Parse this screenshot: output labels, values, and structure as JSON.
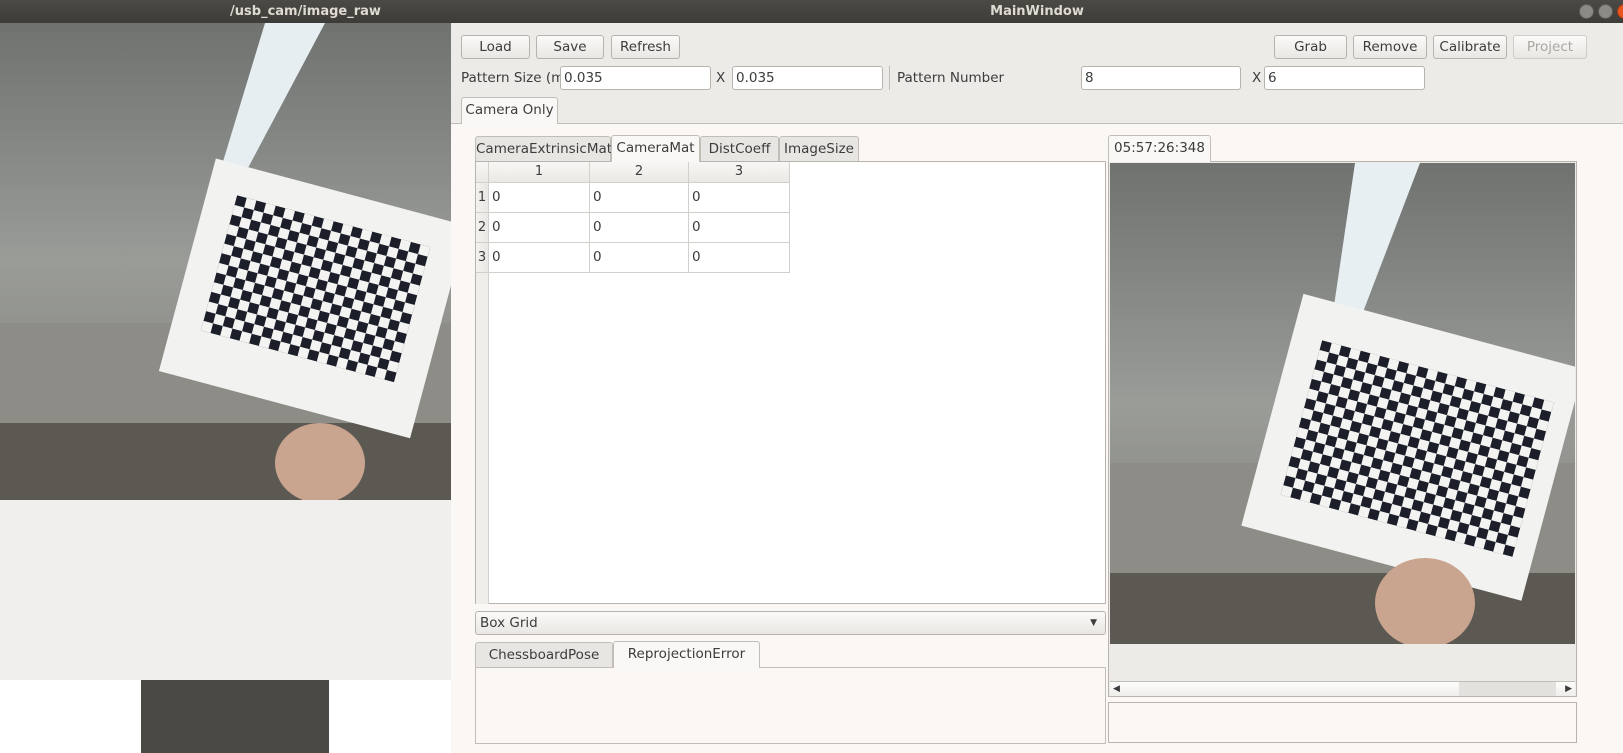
{
  "left_window": {
    "title": "/usb_cam/image_raw"
  },
  "main_window": {
    "title": "MainWindow",
    "toolbar": {
      "load": "Load",
      "save": "Save",
      "refresh": "Refresh",
      "grab": "Grab",
      "remove": "Remove",
      "calibrate": "Calibrate",
      "project": "Project"
    },
    "pattern": {
      "size_label": "Pattern Size (m)",
      "size_x": "0.035",
      "x_label": "X",
      "size_y": "0.035",
      "number_label": "Pattern Number",
      "number_x": "8",
      "number_y": "6"
    },
    "main_tab": "Camera Only",
    "matrix_tabs": [
      "CameraExtrinsicMat",
      "CameraMat",
      "DistCoeff",
      "ImageSize"
    ],
    "active_matrix_tab": "CameraMat",
    "table": {
      "columns": [
        "1",
        "2",
        "3"
      ],
      "row_headers": [
        "1",
        "2",
        "3"
      ],
      "rows": [
        [
          "0",
          "0",
          "0"
        ],
        [
          "0",
          "0",
          "0"
        ],
        [
          "0",
          "0",
          "0"
        ]
      ]
    },
    "dropdown": {
      "selected": "Box Grid"
    },
    "bottom_tabs": [
      "ChessboardPose",
      "ReprojectionError"
    ],
    "active_bottom_tab": "ReprojectionError",
    "image_tab": "05:57:26:348",
    "colors": {
      "titlebar": "#3d3c38",
      "window_bg": "#edebe7",
      "close_button": "#e9541f"
    }
  }
}
